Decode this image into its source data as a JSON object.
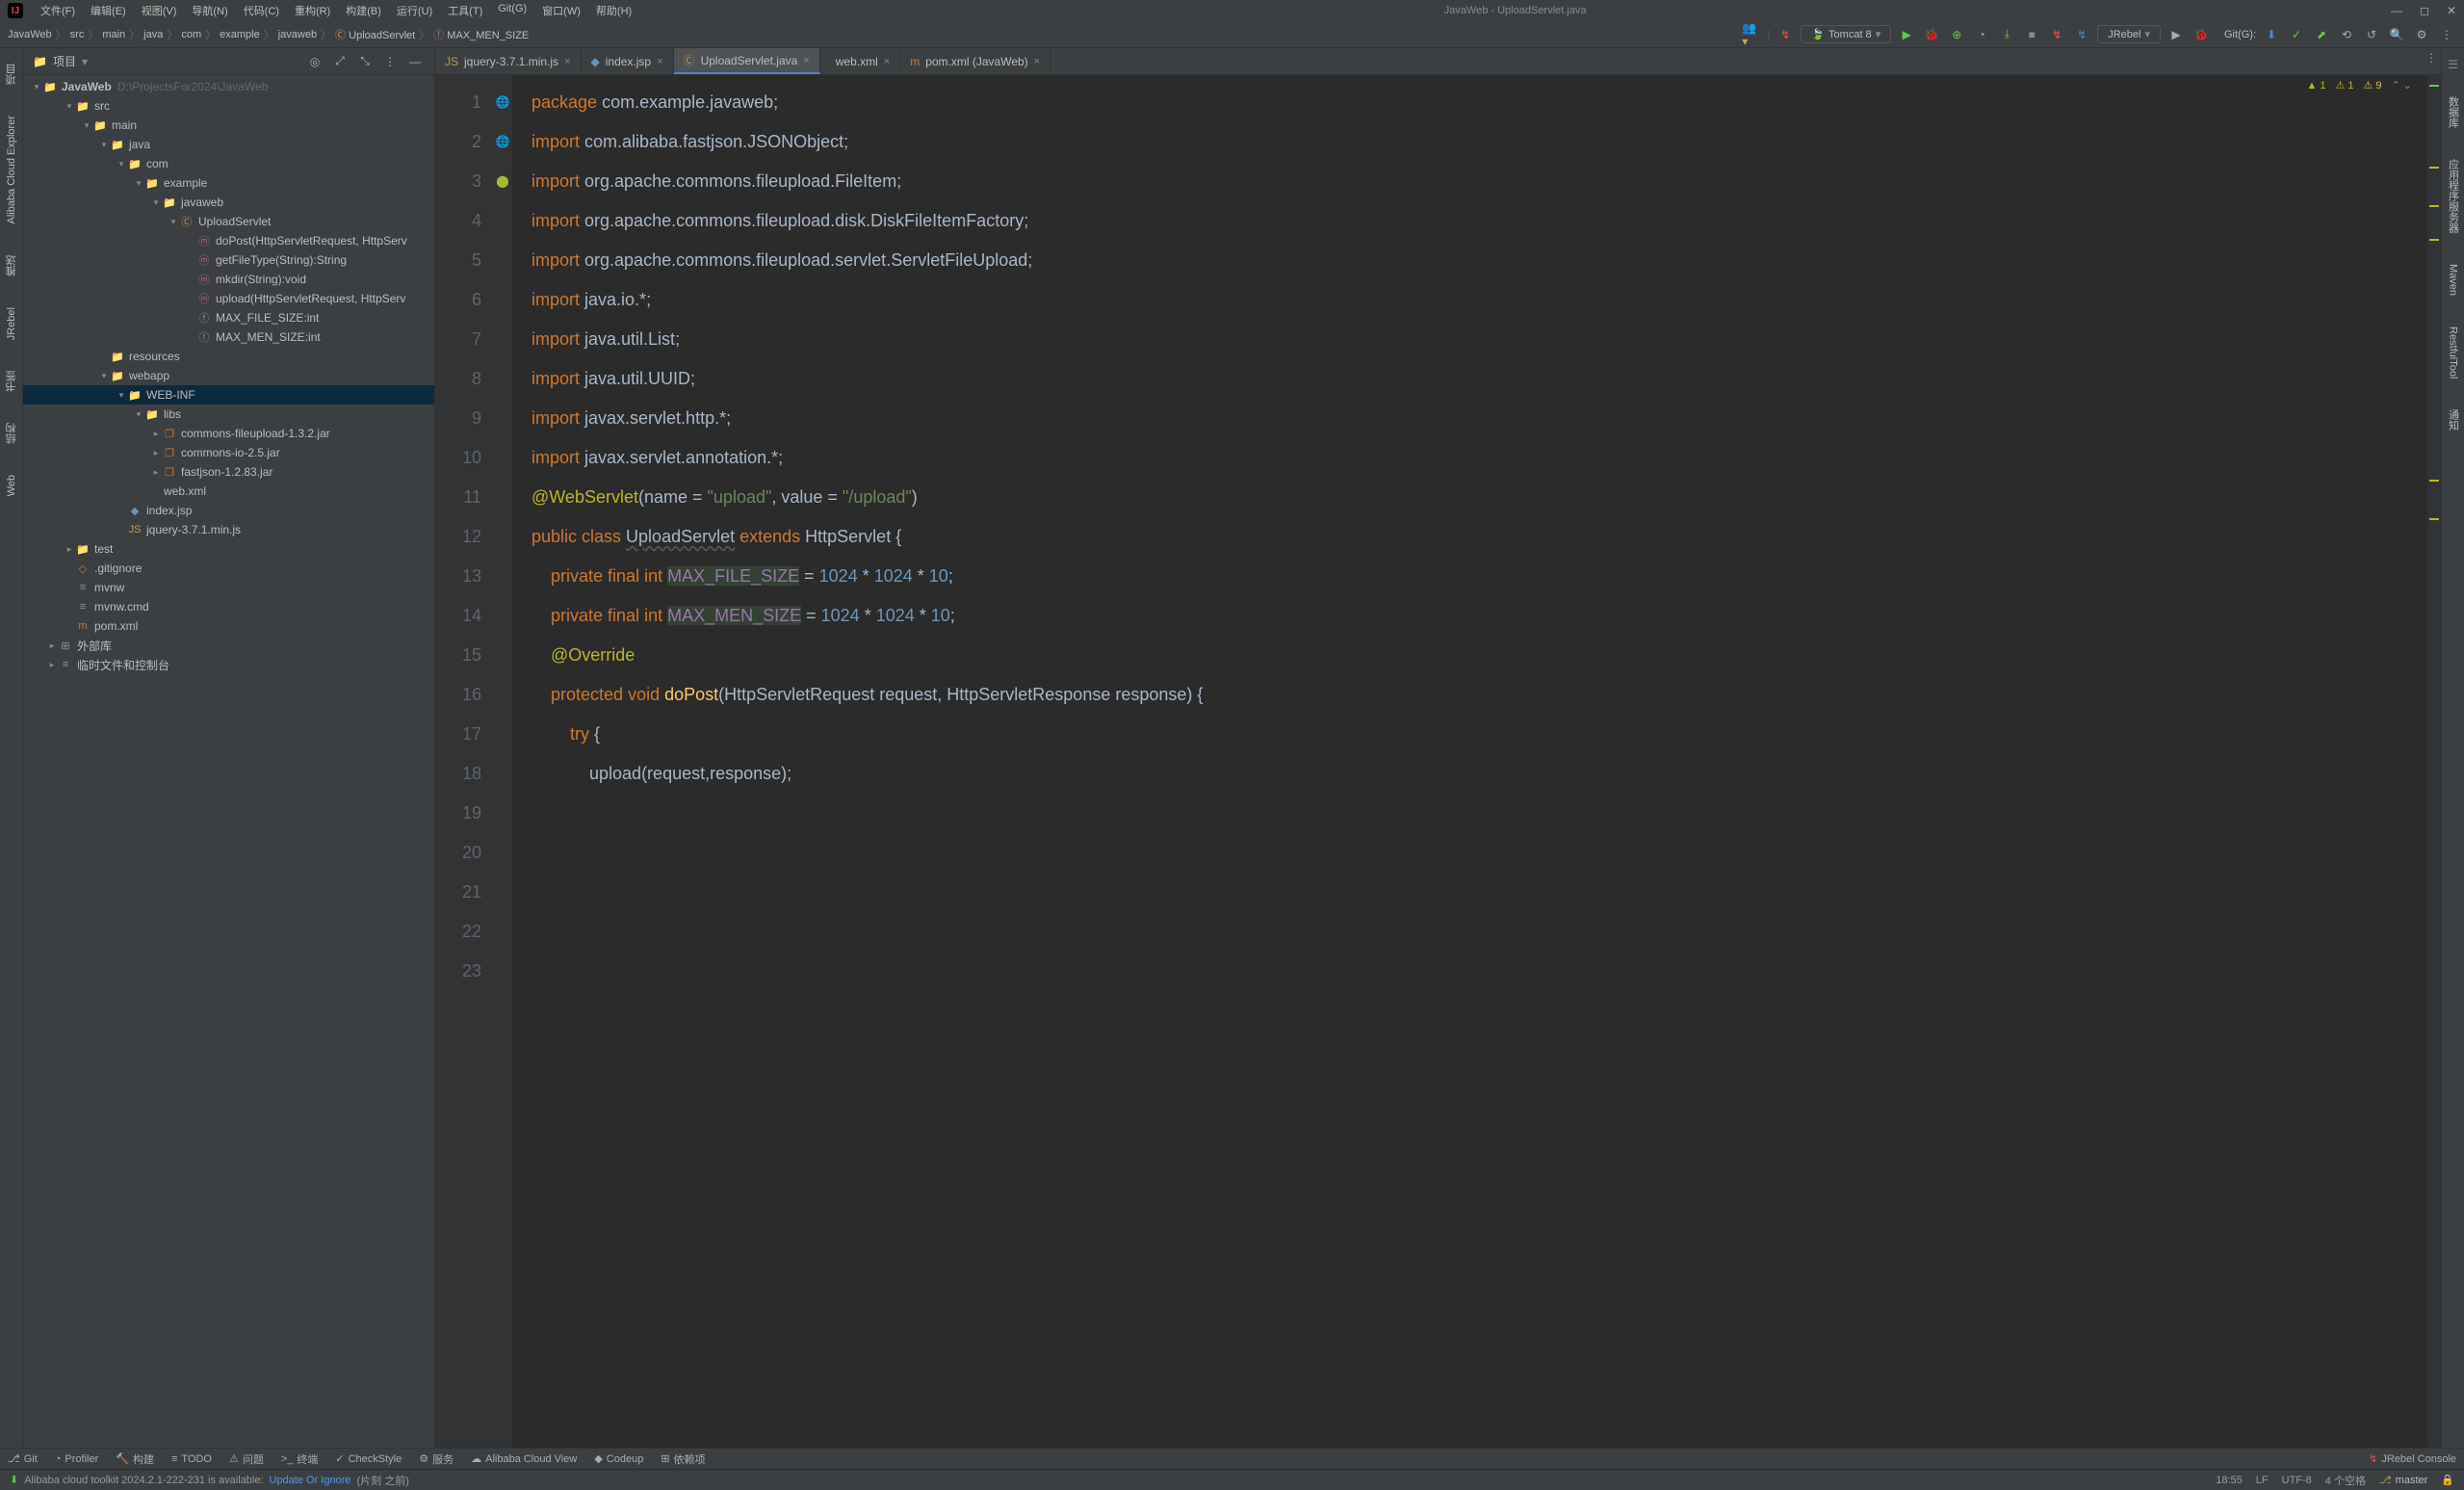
{
  "window": {
    "title": "JavaWeb - UploadServlet.java"
  },
  "menus": [
    "文件(F)",
    "编辑(E)",
    "视图(V)",
    "导航(N)",
    "代码(C)",
    "重构(R)",
    "构建(B)",
    "运行(U)",
    "工具(T)",
    "Git(G)",
    "窗口(W)",
    "帮助(H)"
  ],
  "breadcrumbs": [
    "JavaWeb",
    "src",
    "main",
    "java",
    "com",
    "example",
    "javaweb",
    "UploadServlet",
    "MAX_MEN_SIZE"
  ],
  "run_config": "Tomcat 8",
  "vcs_label": "Git(G):",
  "panel": {
    "title": "项目"
  },
  "tree": {
    "root": {
      "label": "JavaWeb",
      "dim": "D:\\ProjectsFor2024\\JavaWeb"
    },
    "nodes": [
      {
        "pad": 1,
        "arrow": "▾",
        "icon": "📁",
        "cls": "folder-icon",
        "label": "src"
      },
      {
        "pad": 2,
        "arrow": "▾",
        "icon": "📁",
        "cls": "folder-icon",
        "label": "main"
      },
      {
        "pad": 3,
        "arrow": "▾",
        "icon": "📁",
        "cls": "java-icon",
        "label": "java"
      },
      {
        "pad": 4,
        "arrow": "▾",
        "icon": "📁",
        "cls": "pkg-icon",
        "label": "com"
      },
      {
        "pad": 5,
        "arrow": "▾",
        "icon": "📁",
        "cls": "pkg-icon",
        "label": "example"
      },
      {
        "pad": 6,
        "arrow": "▾",
        "icon": "📁",
        "cls": "pkg-icon",
        "label": "javaweb"
      },
      {
        "pad": 7,
        "arrow": "▾",
        "icon": "Ⓒ",
        "cls": "class-icon",
        "label": "UploadServlet"
      },
      {
        "pad": 8,
        "arrow": "",
        "icon": "ⓜ",
        "cls": "method-icon",
        "label": "doPost(HttpServletRequest, HttpServ"
      },
      {
        "pad": 8,
        "arrow": "",
        "icon": "ⓜ",
        "cls": "method-icon",
        "label": "getFileType(String):String"
      },
      {
        "pad": 8,
        "arrow": "",
        "icon": "ⓜ",
        "cls": "method-icon",
        "label": "mkdir(String):void"
      },
      {
        "pad": 8,
        "arrow": "",
        "icon": "ⓜ",
        "cls": "method-icon",
        "label": "upload(HttpServletRequest, HttpServ"
      },
      {
        "pad": 8,
        "arrow": "",
        "icon": "ⓕ",
        "cls": "field-icon",
        "label": "MAX_FILE_SIZE:int"
      },
      {
        "pad": 8,
        "arrow": "",
        "icon": "ⓕ",
        "cls": "field-icon",
        "label": "MAX_MEN_SIZE:int"
      },
      {
        "pad": 3,
        "arrow": "",
        "icon": "📁",
        "cls": "pkg-icon",
        "label": "resources"
      },
      {
        "pad": 3,
        "arrow": "▾",
        "icon": "📁",
        "cls": "java-icon",
        "label": "webapp"
      },
      {
        "pad": 4,
        "arrow": "▾",
        "icon": "📁",
        "cls": "folder-icon",
        "label": "WEB-INF",
        "selected": true
      },
      {
        "pad": 5,
        "arrow": "▾",
        "icon": "📁",
        "cls": "folder-icon",
        "label": "libs"
      },
      {
        "pad": 6,
        "arrow": "▸",
        "icon": "❐",
        "cls": "jar-icon",
        "label": "commons-fileupload-1.3.2.jar"
      },
      {
        "pad": 6,
        "arrow": "▸",
        "icon": "❐",
        "cls": "jar-icon",
        "label": "commons-io-2.5.jar"
      },
      {
        "pad": 6,
        "arrow": "▸",
        "icon": "❐",
        "cls": "jar-icon",
        "label": "fastjson-1.2.83.jar"
      },
      {
        "pad": 5,
        "arrow": "",
        "icon": "</>",
        "cls": "xml-icon",
        "label": "web.xml"
      },
      {
        "pad": 4,
        "arrow": "",
        "icon": "◆",
        "cls": "jsp-icon",
        "label": "index.jsp"
      },
      {
        "pad": 4,
        "arrow": "",
        "icon": "JS",
        "cls": "js-icon",
        "label": "jquery-3.7.1.min.js"
      },
      {
        "pad": 1,
        "arrow": "▸",
        "icon": "📁",
        "cls": "folder-icon",
        "label": "test"
      },
      {
        "pad": 1,
        "arrow": "",
        "icon": "◇",
        "cls": "xml-icon",
        "label": ".gitignore"
      },
      {
        "pad": 1,
        "arrow": "",
        "icon": "≡",
        "cls": "folder-icon",
        "label": "mvnw"
      },
      {
        "pad": 1,
        "arrow": "",
        "icon": "≡",
        "cls": "folder-icon",
        "label": "mvnw.cmd"
      },
      {
        "pad": 1,
        "arrow": "",
        "icon": "m",
        "cls": "xml-icon",
        "label": "pom.xml"
      },
      {
        "pad": 0,
        "arrow": "▸",
        "icon": "⊞",
        "cls": "folder-icon",
        "label": "外部库"
      },
      {
        "pad": 0,
        "arrow": "▸",
        "icon": "≡",
        "cls": "folder-icon",
        "label": "临时文件和控制台"
      }
    ]
  },
  "tabs": [
    {
      "icon": "JS",
      "cls": "js-icon",
      "label": "jquery-3.7.1.min.js"
    },
    {
      "icon": "◆",
      "cls": "jsp-icon",
      "label": "index.jsp"
    },
    {
      "icon": "Ⓒ",
      "cls": "class-icon",
      "label": "UploadServlet.java",
      "active": true
    },
    {
      "icon": "</>",
      "cls": "xml-icon",
      "label": "web.xml"
    },
    {
      "icon": "m",
      "cls": "xml-icon",
      "label": "pom.xml (JavaWeb)"
    }
  ],
  "warnings": {
    "yellow": "1",
    "warn_yellow": "1",
    "err": "9",
    "arrows": "⌃ ⌄"
  },
  "gutter_lines": [
    "1",
    "2",
    "3",
    "4",
    "5",
    "6",
    "7",
    "8",
    "9",
    "10",
    "11",
    "12",
    "13",
    "14",
    "15",
    "16",
    "17",
    "18",
    "19",
    "20",
    "21",
    "22",
    "23"
  ],
  "code_lines": [
    {
      "t": [
        [
          "kw",
          "package "
        ],
        [
          "cls",
          "com.example.javaweb"
        ],
        [
          "",
          ";"
        ]
      ]
    },
    {
      "t": [
        [
          "",
          ""
        ]
      ]
    },
    {
      "t": [
        [
          "kw",
          "import "
        ],
        [
          "cls",
          "com.alibaba.fastjson.JSONObject"
        ],
        [
          "",
          ";"
        ]
      ]
    },
    {
      "t": [
        [
          "kw",
          "import "
        ],
        [
          "cls",
          "org.apache.commons.fileupload.FileItem"
        ],
        [
          "",
          ";"
        ]
      ]
    },
    {
      "t": [
        [
          "kw",
          "import "
        ],
        [
          "cls",
          "org.apache.commons.fileupload.disk.DiskFileItemFactory"
        ],
        [
          "",
          ";"
        ]
      ]
    },
    {
      "t": [
        [
          "kw",
          "import "
        ],
        [
          "cls",
          "org.apache.commons.fileupload.servlet.ServletFileUpload"
        ],
        [
          "",
          ";"
        ]
      ]
    },
    {
      "t": [
        [
          "kw",
          "import "
        ],
        [
          "cls",
          "java.io.*"
        ],
        [
          "",
          ";"
        ]
      ]
    },
    {
      "t": [
        [
          "kw",
          "import "
        ],
        [
          "cls",
          "java.util.List"
        ],
        [
          "",
          ";"
        ]
      ]
    },
    {
      "t": [
        [
          "kw",
          "import "
        ],
        [
          "cls",
          "java.util.UUID"
        ],
        [
          "",
          ";"
        ]
      ]
    },
    {
      "t": [
        [
          "kw",
          "import "
        ],
        [
          "cls",
          "javax.servlet.http.*"
        ],
        [
          "",
          ";"
        ]
      ]
    },
    {
      "t": [
        [
          "kw",
          "import "
        ],
        [
          "cls",
          "javax.servlet.annotation.*"
        ],
        [
          "",
          ";"
        ]
      ]
    },
    {
      "t": [
        [
          "",
          ""
        ]
      ]
    },
    {
      "t": [
        [
          "ann",
          "@WebServlet"
        ],
        [
          "",
          "(name = "
        ],
        [
          "str",
          "\"upload\""
        ],
        [
          "",
          ", value = "
        ],
        [
          "str",
          "\"/upload\""
        ],
        [
          "",
          ")"
        ]
      ]
    },
    {
      "t": [
        [
          "kw",
          "public class "
        ],
        [
          "cls underline",
          "UploadServlet"
        ],
        [
          "kw",
          " extends "
        ],
        [
          "cls",
          "HttpServlet"
        ],
        [
          "",
          " {"
        ]
      ]
    },
    {
      "t": [
        [
          "",
          ""
        ]
      ]
    },
    {
      "t": [
        [
          "",
          "    "
        ],
        [
          "kw",
          "private final int "
        ],
        [
          "const-hl",
          "MAX_FILE_SIZE"
        ],
        [
          "",
          " = "
        ],
        [
          "num",
          "1024"
        ],
        [
          "",
          " * "
        ],
        [
          "num",
          "1024"
        ],
        [
          "",
          " * "
        ],
        [
          "num",
          "10"
        ],
        [
          "",
          ";"
        ]
      ]
    },
    {
      "t": [
        [
          "",
          ""
        ]
      ]
    },
    {
      "t": [
        [
          "",
          "    "
        ],
        [
          "kw",
          "private final int "
        ],
        [
          "const-hl",
          "MAX_MEN_SIZE"
        ],
        [
          "",
          " = "
        ],
        [
          "num",
          "1024"
        ],
        [
          "",
          " * "
        ],
        [
          "num",
          "1024"
        ],
        [
          "",
          " * "
        ],
        [
          "num",
          "10"
        ],
        [
          "",
          ";"
        ]
      ],
      "hl": true
    },
    {
      "t": [
        [
          "",
          ""
        ]
      ]
    },
    {
      "t": [
        [
          "",
          "    "
        ],
        [
          "ann",
          "@Override"
        ]
      ]
    },
    {
      "t": [
        [
          "",
          "    "
        ],
        [
          "kw",
          "protected void "
        ],
        [
          "fn",
          "doPost"
        ],
        [
          "",
          "(HttpServletRequest request, HttpServletResponse response) {"
        ]
      ]
    },
    {
      "t": [
        [
          "",
          "        "
        ],
        [
          "kw",
          "try"
        ],
        [
          "",
          " {"
        ]
      ]
    },
    {
      "t": [
        [
          "",
          "            upload(request,response);"
        ]
      ]
    }
  ],
  "gutter_marks": {
    "13": "🌐",
    "14": "🌐",
    "21": "⬤"
  },
  "left_tools": [
    "项目",
    "Alibaba Cloud Explorer",
    "推送",
    "JRebel",
    "书签",
    "结构",
    "Web"
  ],
  "right_tools": [
    "数据库",
    "应用程序服务器",
    "Maven",
    "RestfulTool",
    "通知"
  ],
  "bottom_tabs": [
    {
      "icon": "⎇",
      "label": "Git"
    },
    {
      "icon": "◔",
      "label": "Profiler"
    },
    {
      "icon": "🔨",
      "label": "构建"
    },
    {
      "icon": "≡",
      "label": "TODO"
    },
    {
      "icon": "⚠",
      "label": "问题"
    },
    {
      "icon": ">_",
      "label": "终端"
    },
    {
      "icon": "✓",
      "label": "CheckStyle"
    },
    {
      "icon": "⚙",
      "label": "服务"
    },
    {
      "icon": "☁",
      "label": "Alibaba Cloud View"
    },
    {
      "icon": "◆",
      "label": "Codeup"
    },
    {
      "icon": "⊞",
      "label": "依赖项"
    }
  ],
  "bottom_right": {
    "label": "JRebel Console"
  },
  "status": {
    "msg": "Alibaba cloud toolkit 2024.2.1-222-231 is available:",
    "link": "Update Or Ignore",
    "extra": "(片刻 之前)",
    "pos": "18:55",
    "lf": "LF",
    "enc": "UTF-8",
    "indent": "4 个空格",
    "branch": "master"
  }
}
